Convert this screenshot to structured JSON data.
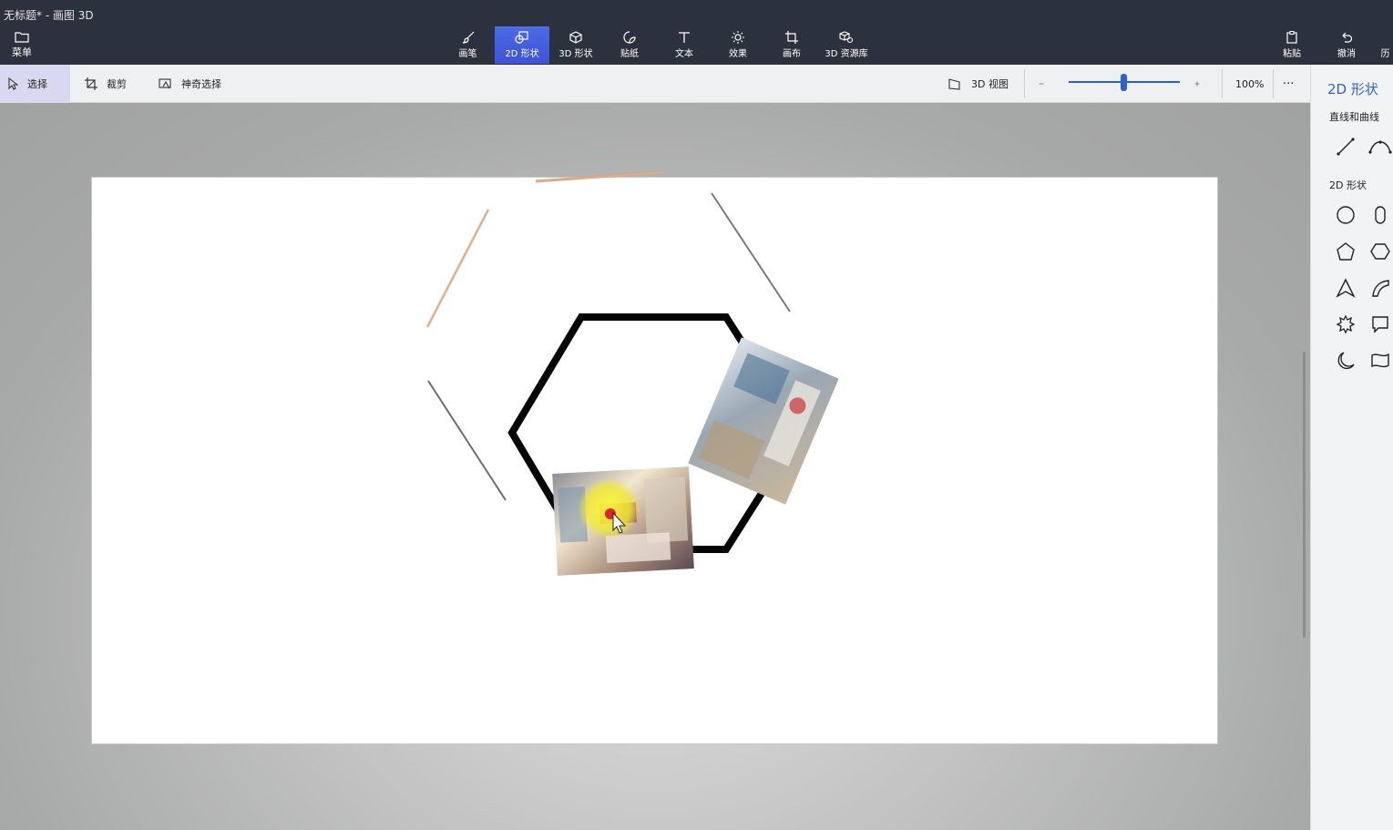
{
  "window": {
    "title": "无标题* - 画图 3D"
  },
  "menu": {
    "label": "菜单"
  },
  "tools": [
    {
      "label": "画笔"
    },
    {
      "label": "2D 形状"
    },
    {
      "label": "3D 形状"
    },
    {
      "label": "贴纸"
    },
    {
      "label": "文本"
    },
    {
      "label": "效果"
    },
    {
      "label": "画布"
    },
    {
      "label": "3D 资源库"
    }
  ],
  "actions": {
    "paste": "粘贴",
    "undo": "撤消",
    "history": "历"
  },
  "subtoolbar": {
    "select": "选择",
    "crop": "裁剪",
    "magic_select": "神奇选择",
    "view3d": "3D 视图",
    "zoom": "100%",
    "zoom_level": 0.5,
    "more": "···"
  },
  "panel": {
    "title": "2D 形状",
    "section_lines": "直线和曲线",
    "section_shapes": "2D 形状"
  },
  "colors": {
    "accent": "#2f62cf",
    "active_tool": "#4b6be8",
    "title_bar": "#2c323d"
  }
}
